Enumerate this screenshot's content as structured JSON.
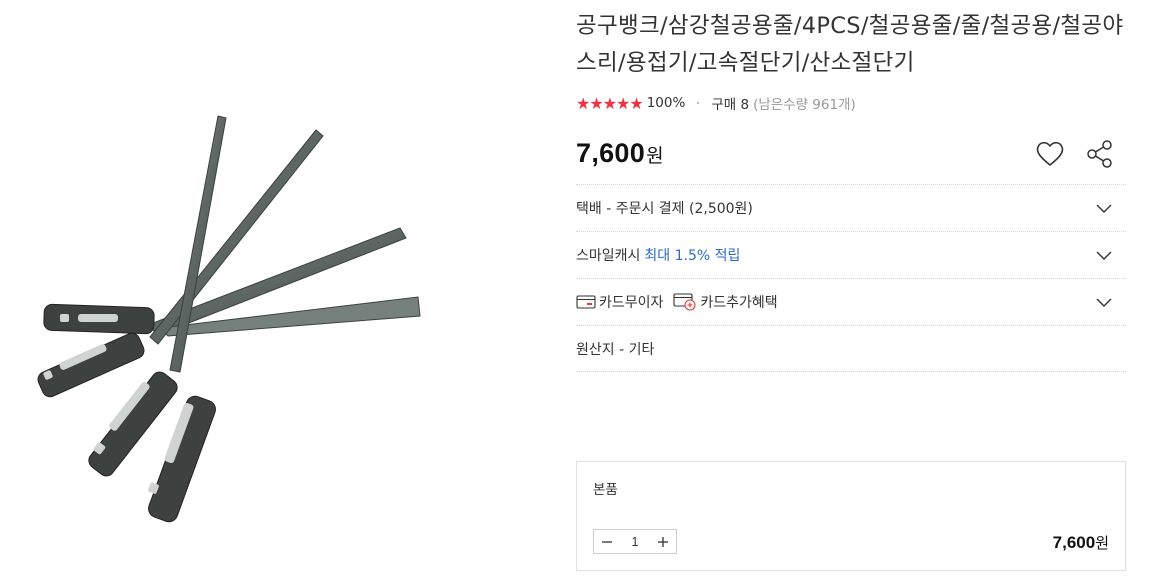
{
  "product": {
    "image_alt": "철공용줄 4PCS",
    "title": "공구뱅크/삼강철공용줄/4PCS/철공용줄/줄/철공용/철공야스리/용접기/고속절단기/산소절단기",
    "rating_stars": "★★★★★",
    "rating_percent": "100%",
    "purchase_count": "구매 8",
    "stock": "(남은수량 961개)",
    "price": "7,600",
    "price_unit": "원"
  },
  "sections": {
    "shipping": "택배 - 주문시 결제 (2,500원)",
    "smilecash_label": "스마일캐시",
    "smilecash_highlight": "최대 1.5% 적립",
    "card_interest_free": "카드무이자",
    "card_benefit": "카드추가혜택",
    "origin": "원산지 - 기타"
  },
  "option": {
    "label": "본품",
    "quantity": "1",
    "price": "7,600",
    "price_unit": "원"
  },
  "icons": {
    "heart": "heart-icon",
    "share": "share-icon",
    "chevron": "chevron-down-icon",
    "minus": "minus-icon",
    "plus": "plus-icon",
    "card": "card-icon",
    "card_plus": "card-plus-icon"
  },
  "colors": {
    "star": "#f43142",
    "highlight": "#2c6bc0"
  }
}
